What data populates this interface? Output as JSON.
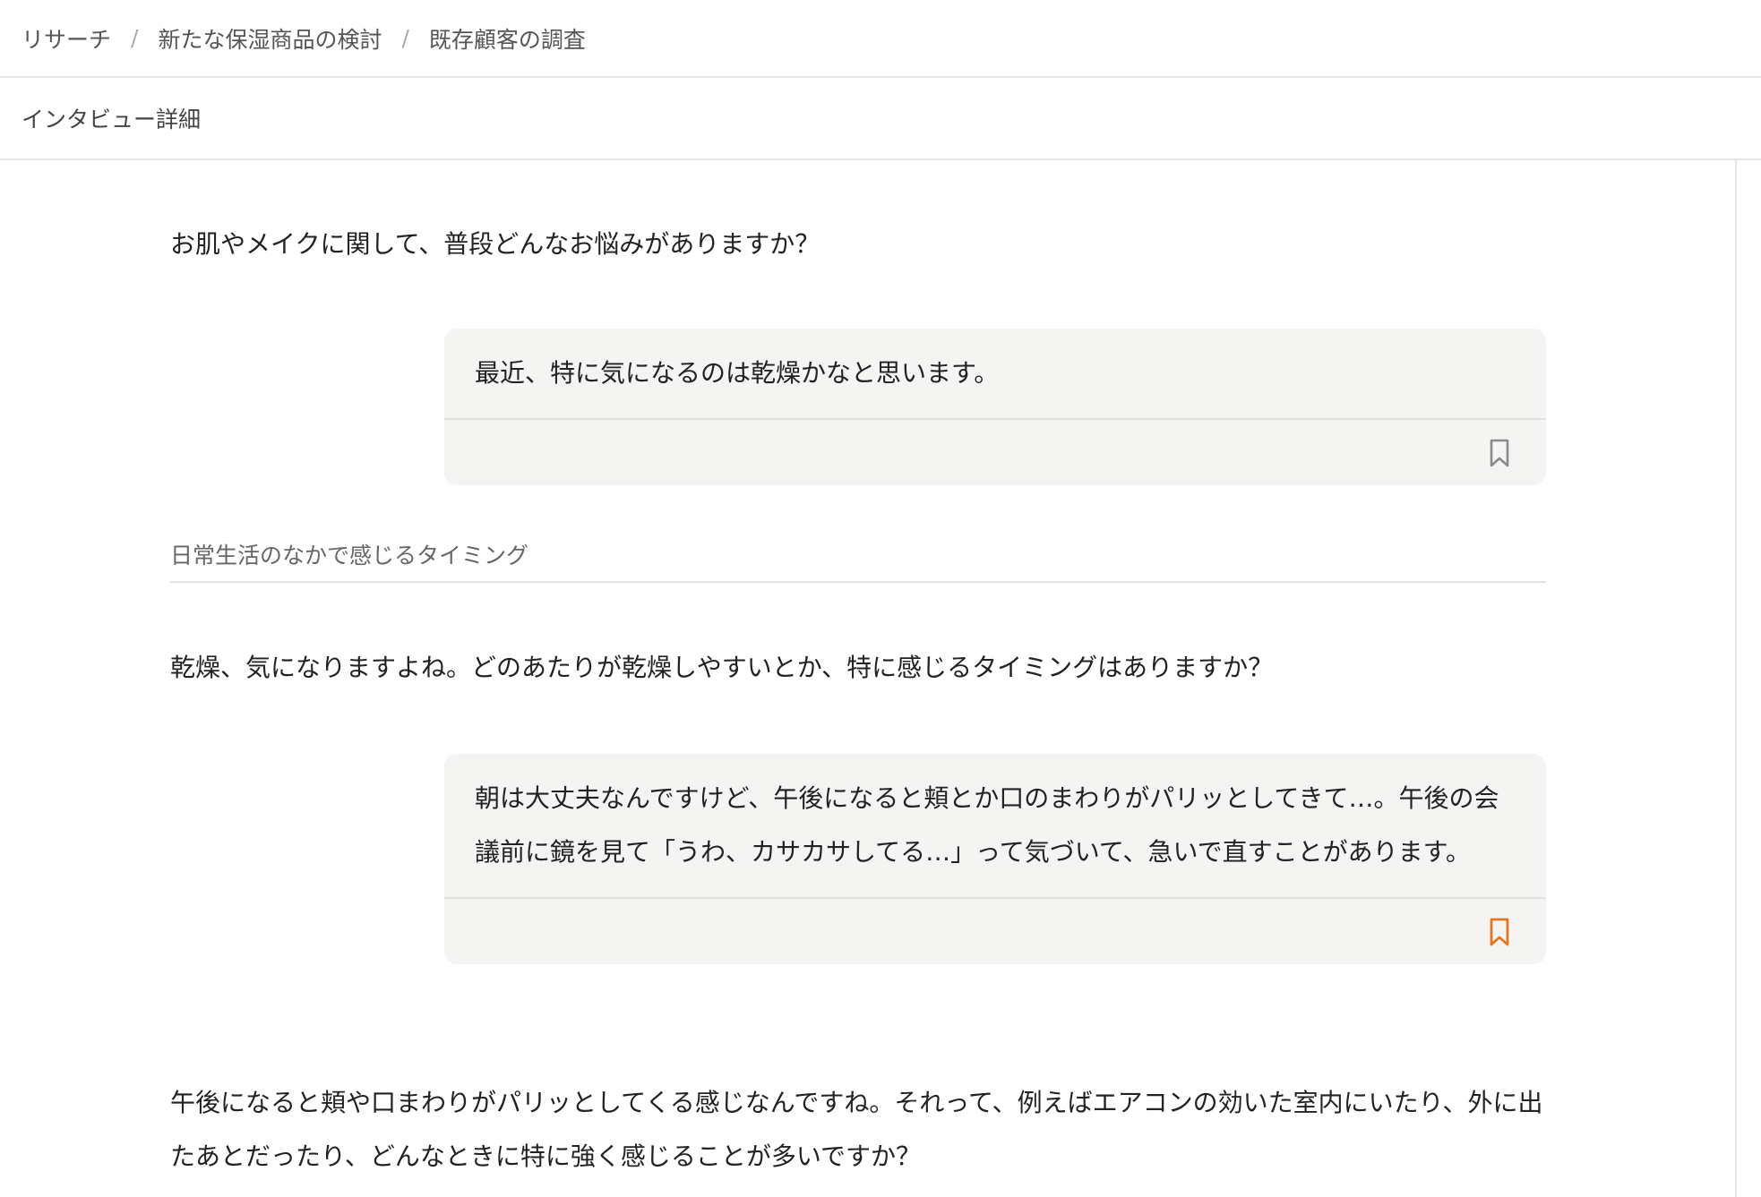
{
  "breadcrumb": {
    "items": [
      "リサーチ",
      "新たな保湿商品の検討",
      "既存顧客の調査"
    ],
    "separator": "/"
  },
  "subheader": {
    "title": "インタビュー詳細"
  },
  "conversation": {
    "q1": "お肌やメイクに関して、普段どんなお悩みがありますか？",
    "a1": "最近、特に気になるのは乾燥かなと思います。",
    "a1_bookmarked": false,
    "topic1": "日常生活のなかで感じるタイミング",
    "q2": "乾燥、気になりますよね。どのあたりが乾燥しやすいとか、特に感じるタイミングはありますか？",
    "a2": "朝は大丈夫なんですけど、午後になると頬とか口のまわりがパリッとしてきて…。午後の会議前に鏡を見て「うわ、カサカサしてる…」って気づいて、急いで直すことがあります。",
    "a2_bookmarked": true,
    "q3": "午後になると頬や口まわりがパリッとしてくる感じなんですね。それって、例えばエアコンの効いた室内にいたり、外に出たあとだったり、どんなときに特に強く感じることが多いですか？"
  },
  "colors": {
    "bookmark_inactive": "#8a8a8a",
    "bookmark_active": "#e8741c",
    "card_bg": "#f4f4f3"
  },
  "icons": {
    "bookmark": "bookmark-icon"
  }
}
